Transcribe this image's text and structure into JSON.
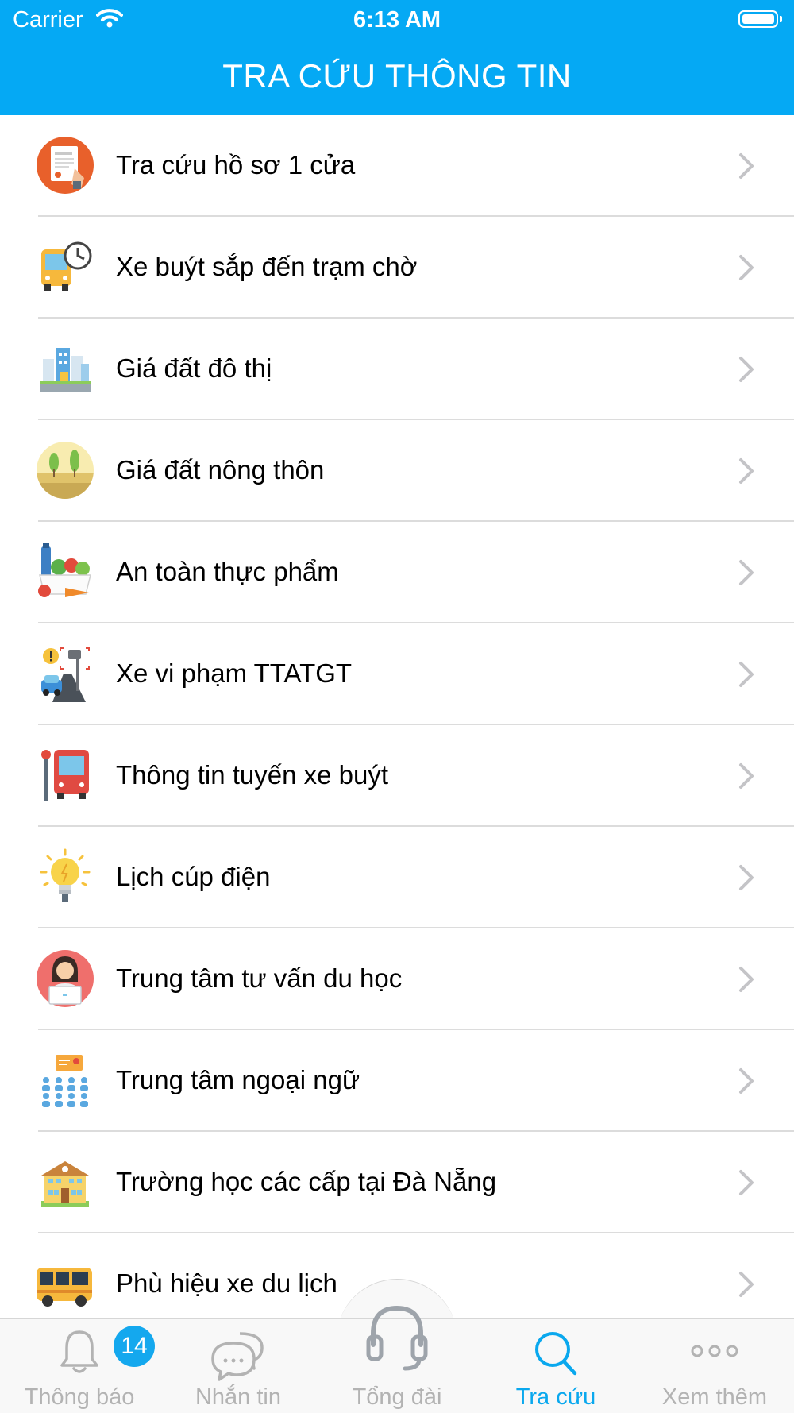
{
  "status_bar": {
    "carrier": "Carrier",
    "time": "6:13 AM"
  },
  "header": {
    "title": "TRA CỨU THÔNG TIN"
  },
  "items": [
    {
      "label": "Tra cứu hồ sơ 1 cửa",
      "icon": "document-icon"
    },
    {
      "label": "Xe buýt sắp đến trạm chờ",
      "icon": "bus-clock-icon"
    },
    {
      "label": "Giá đất đô thị",
      "icon": "city-buildings-icon"
    },
    {
      "label": "Giá đất nông thôn",
      "icon": "countryside-icon"
    },
    {
      "label": "An toàn thực phẩm",
      "icon": "food-basket-icon"
    },
    {
      "label": "Xe vi phạm TTATGT",
      "icon": "traffic-camera-icon"
    },
    {
      "label": "Thông tin tuyến xe buýt",
      "icon": "bus-stop-icon"
    },
    {
      "label": "Lịch cúp điện",
      "icon": "light-bulb-icon"
    },
    {
      "label": "Trung tâm tư vấn du học",
      "icon": "consultant-icon"
    },
    {
      "label": "Trung tâm ngoại ngữ",
      "icon": "classroom-icon"
    },
    {
      "label": "Trường học các cấp tại Đà Nẵng",
      "icon": "school-building-icon"
    },
    {
      "label": "Phù hiệu xe du lịch",
      "icon": "tour-bus-icon"
    }
  ],
  "tabbar": {
    "tabs": [
      {
        "label": "Thông báo",
        "icon": "bell-icon",
        "badge": "14"
      },
      {
        "label": "Nhắn tin",
        "icon": "chat-icon"
      },
      {
        "label": "Tổng đài",
        "icon": "headset-icon"
      },
      {
        "label": "Tra cứu",
        "icon": "search-icon",
        "active": true
      },
      {
        "label": "Xem thêm",
        "icon": "more-icon"
      }
    ]
  },
  "colors": {
    "primary": "#05a9f4",
    "active_tab": "#0aa8ee",
    "inactive_tab": "#b3b3b3",
    "badge": "#14a8ee"
  }
}
